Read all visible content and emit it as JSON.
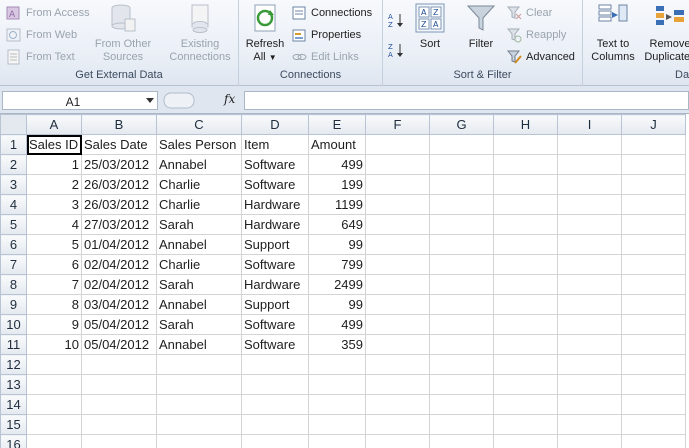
{
  "ribbon": {
    "get_external_data": {
      "label": "Get External Data",
      "from_access": "From Access",
      "from_web": "From Web",
      "from_text": "From Text",
      "from_other_sources": [
        "From Other",
        "Sources"
      ],
      "existing_connections": [
        "Existing",
        "Connections"
      ]
    },
    "connections": {
      "label": "Connections",
      "refresh_all": [
        "Refresh",
        "All"
      ],
      "connections": "Connections",
      "properties": "Properties",
      "edit_links": "Edit Links"
    },
    "sort_filter": {
      "label": "Sort & Filter",
      "sort": "Sort",
      "filter": "Filter",
      "clear": "Clear",
      "reapply": "Reapply",
      "advanced": "Advanced"
    },
    "data_tools": {
      "label": "Da",
      "text_to_columns": [
        "Text to",
        "Columns"
      ],
      "remove_duplicates": [
        "Remove",
        "Duplicates"
      ]
    }
  },
  "formula_bar": {
    "name_box": "A1",
    "fx": "fx",
    "formula": ""
  },
  "sheet": {
    "columns": [
      "A",
      "B",
      "C",
      "D",
      "E",
      "F",
      "G",
      "H",
      "I",
      "J"
    ],
    "rows": [
      [
        "Sales ID",
        "Sales Date",
        "Sales Person",
        "Item",
        "Amount"
      ],
      [
        "1",
        "25/03/2012",
        "Annabel",
        "Software",
        "499"
      ],
      [
        "2",
        "26/03/2012",
        "Charlie",
        "Software",
        "199"
      ],
      [
        "3",
        "26/03/2012",
        "Charlie",
        "Hardware",
        "1199"
      ],
      [
        "4",
        "27/03/2012",
        "Sarah",
        "Hardware",
        "649"
      ],
      [
        "5",
        "01/04/2012",
        "Annabel",
        "Support",
        "99"
      ],
      [
        "6",
        "02/04/2012",
        "Charlie",
        "Software",
        "799"
      ],
      [
        "7",
        "02/04/2012",
        "Sarah",
        "Hardware",
        "2499"
      ],
      [
        "8",
        "03/04/2012",
        "Annabel",
        "Support",
        "99"
      ],
      [
        "9",
        "05/04/2012",
        "Sarah",
        "Software",
        "499"
      ],
      [
        "10",
        "05/04/2012",
        "Annabel",
        "Software",
        "359"
      ],
      [
        "",
        "",
        "",
        "",
        ""
      ],
      [
        "",
        "",
        "",
        "",
        ""
      ],
      [
        "",
        "",
        "",
        "",
        ""
      ],
      [
        "",
        "",
        "",
        "",
        ""
      ],
      [
        "",
        "",
        "",
        "",
        ""
      ]
    ],
    "row_numbers": [
      "1",
      "2",
      "3",
      "4",
      "5",
      "6",
      "7",
      "8",
      "9",
      "10",
      "11",
      "12",
      "13",
      "14",
      "15",
      "16"
    ]
  }
}
